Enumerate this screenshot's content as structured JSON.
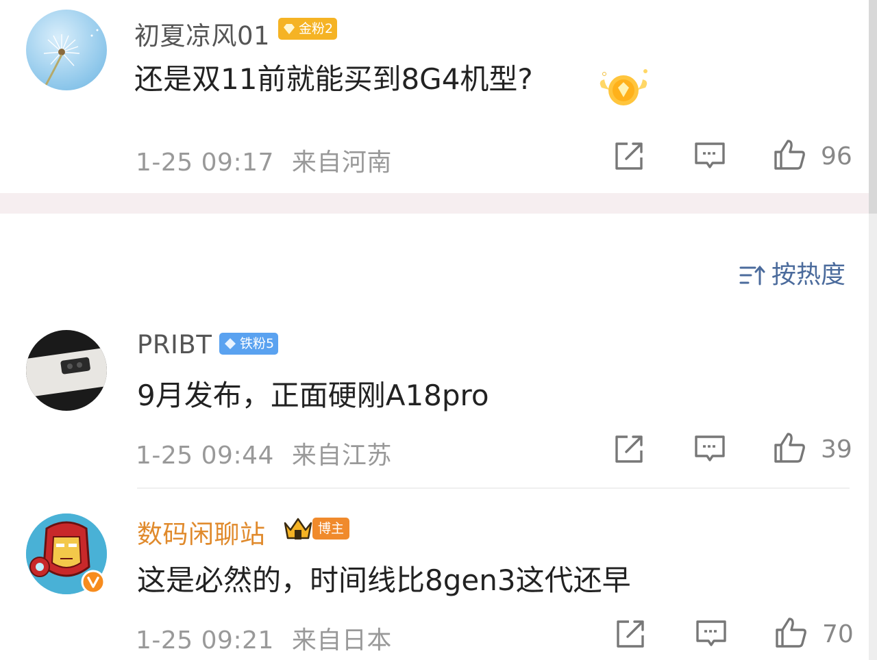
{
  "comments": [
    {
      "username": "初夏凉风01",
      "badge": "金粉2",
      "text": "还是双11前就能买到8G4机型?",
      "time": "1-25 09:17",
      "location": "来自河南",
      "likes": "96",
      "name_color": "#555555",
      "avatar_icon": "dandelion-avatar"
    },
    {
      "username": "PRIBT",
      "badge": "铁粉5",
      "text": "9月发布，正面硬刚A18pro",
      "time": "1-25 09:44",
      "location": "来自江苏",
      "likes": "39",
      "name_color": "#555555",
      "avatar_icon": "phone-avatar"
    },
    {
      "username": "数码闲聊站",
      "badge": "博主",
      "text": "这是必然的，时间线比8gen3这代还早",
      "time": "1-25 09:21",
      "location": "来自日本",
      "likes": "70",
      "name_color": "#e08a2c",
      "avatar_icon": "ironman-avatar"
    }
  ],
  "sort": {
    "label": "按热度",
    "icon": "sort-icon"
  },
  "colors": {
    "gold_badge": "#f5b324",
    "iron_badge": "#5aa2f0",
    "blogger_badge": "#f08a2c",
    "accent": "#4b6b9c"
  }
}
